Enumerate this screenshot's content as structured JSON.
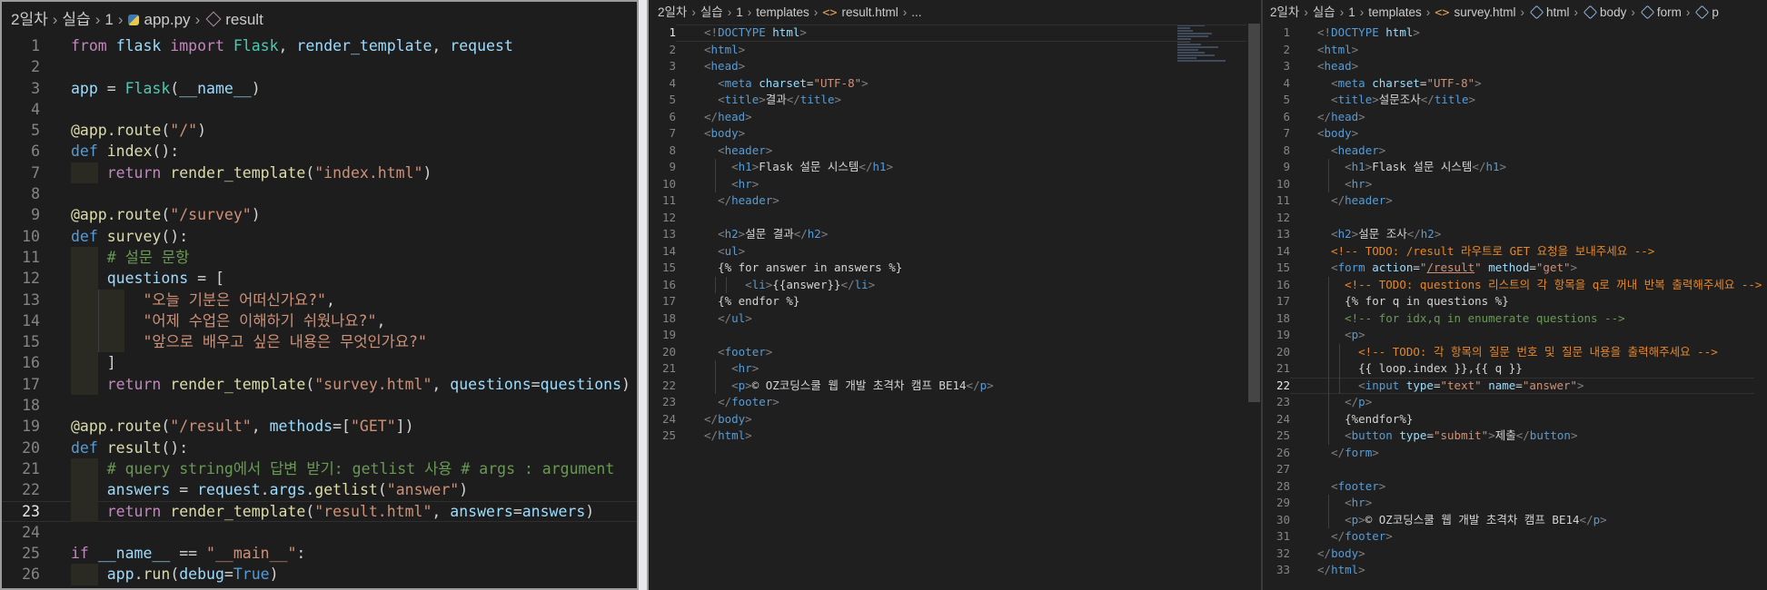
{
  "left_pane": {
    "breadcrumb": [
      "2일차",
      "실습",
      "1",
      "app.py",
      "result"
    ],
    "current_line": 23,
    "lines": [
      "from flask import Flask, render_template, request",
      "",
      "app = Flask(__name__)",
      "",
      "@app.route(\"/\")",
      "def index():",
      "    return render_template(\"index.html\")",
      "",
      "@app.route(\"/survey\")",
      "def survey():",
      "    # 설문 문항",
      "    questions = [",
      "        \"오늘 기분은 어떠신가요?\",",
      "        \"어제 수업은 이해하기 쉬웠나요?\",",
      "        \"앞으로 배우고 싶은 내용은 무엇인가요?\"",
      "    ]",
      "    return render_template(\"survey.html\", questions=questions)",
      "",
      "@app.route(\"/result\", methods=[\"GET\"])",
      "def result():",
      "    # query string에서 답변 받기: getlist 사용 # args : argument",
      "    answers = request.args.getlist(\"answer\")",
      "    return render_template(\"result.html\", answers=answers)",
      "",
      "if __name__ == \"__main__\":",
      "    app.run(debug=True)"
    ]
  },
  "middle_pane": {
    "breadcrumb": [
      "2일차",
      "실습",
      "1",
      "templates",
      "result.html",
      "..."
    ],
    "current_line": 1,
    "lines": [
      "<!DOCTYPE html>",
      "<html>",
      "<head>",
      "  <meta charset=\"UTF-8\">",
      "  <title>결과</title>",
      "</head>",
      "<body>",
      "  <header>",
      "    <h1>Flask 설문 시스템</h1>",
      "    <hr>",
      "  </header>",
      "",
      "  <h2>설문 결과</h2>",
      "  <ul>",
      "  {% for answer in answers %}",
      "      <li>{{answer}}</li>",
      "  {% endfor %}",
      "  </ul>",
      "",
      "  <footer>",
      "    <hr>",
      "    <p>© OZ코딩스쿨 웹 개발 초격차 캠프 BE14</p>",
      "  </footer>",
      "</body>",
      "</html>"
    ]
  },
  "right_pane": {
    "breadcrumb": [
      "2일차",
      "실습",
      "1",
      "templates",
      "survey.html",
      "html",
      "body",
      "form",
      "p"
    ],
    "current_line": 22,
    "lines": [
      "<!DOCTYPE html>",
      "<html>",
      "<head>",
      "  <meta charset=\"UTF-8\">",
      "  <title>설문조사</title>",
      "</head>",
      "<body>",
      "  <header>",
      "    <h1>Flask 설문 시스템</h1>",
      "    <hr>",
      "  </header>",
      "",
      "  <h2>설문 조사</h2>",
      "  <!-- TODO: /result 라우트로 GET 요청을 보내주세요 -->",
      "  <form action=\"/result\" method=\"get\">",
      "    <!-- TODO: questions 리스트의 각 항목을 q로 꺼내 반복 출력해주세요 -->",
      "    {% for q in questions %}",
      "    <!-- for idx,q in enumerate questions -->",
      "    <p>",
      "      <!-- TODO: 각 항목의 질문 번호 및 질문 내용을 출력해주세요 -->",
      "      {{ loop.index }},{{ q }}",
      "      <input type=\"text\" name=\"answer\">",
      "    </p>",
      "    {%endfor%}",
      "    <button type=\"submit\">제출</button>",
      "  </form>",
      "",
      "  <footer>",
      "    <hr>",
      "    <p>© OZ코딩스쿨 웹 개발 초격차 캠프 BE14</p>",
      "  </footer>",
      "</body>",
      "</html>"
    ]
  }
}
